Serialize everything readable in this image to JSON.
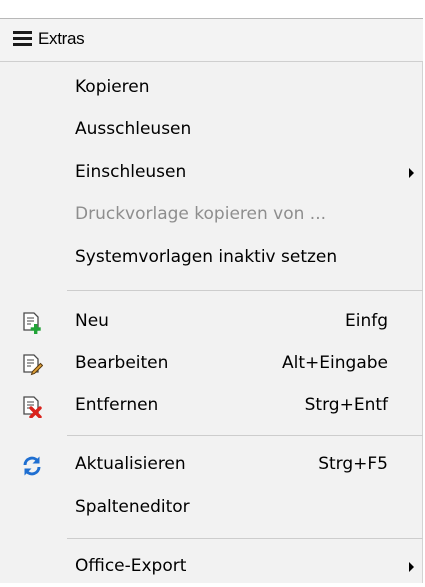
{
  "menu": {
    "title": "Extras",
    "icon": "hamburger-icon"
  },
  "items": [
    {
      "label": "Kopieren",
      "disabled": false
    },
    {
      "label": "Ausschleusen",
      "disabled": false
    },
    {
      "label": "Einschleusen",
      "disabled": false,
      "submenu": true
    },
    {
      "label": "Druckvorlage kopieren von ...",
      "disabled": true
    },
    {
      "label": "Systemvorlagen inaktiv setzen",
      "disabled": false
    },
    {
      "label": "Neu",
      "shortcut": "Einfg",
      "icon": "new-document-icon"
    },
    {
      "label": "Bearbeiten",
      "shortcut": "Alt+Eingabe",
      "icon": "edit-document-icon"
    },
    {
      "label": "Entfernen",
      "shortcut": "Strg+Entf",
      "icon": "delete-document-icon"
    },
    {
      "label": "Aktualisieren",
      "shortcut": "Strg+F5",
      "icon": "refresh-icon"
    },
    {
      "label": "Spalteneditor"
    },
    {
      "label": "Office-Export",
      "submenu": true
    }
  ],
  "colors": {
    "disabled_text": "#8e8e8e",
    "new_icon_accent": "#21a337",
    "delete_icon_accent": "#d9231c",
    "refresh_icon": "#1f6fd1"
  }
}
